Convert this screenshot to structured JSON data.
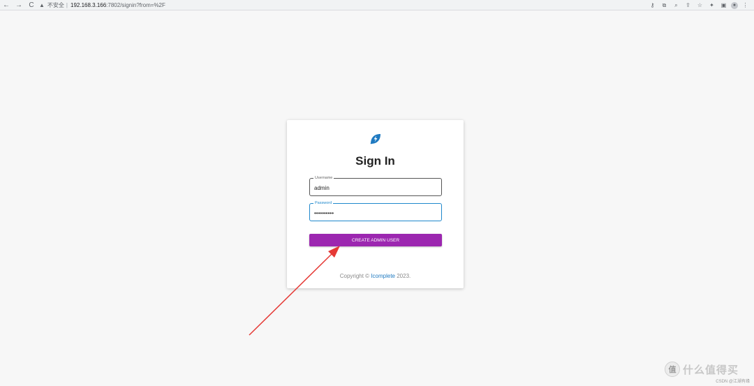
{
  "browser": {
    "back_icon": "←",
    "forward_icon": "→",
    "reload_icon": "C",
    "security_label": "不安全",
    "separator": "|",
    "url_host": "192.168.3.166",
    "url_path": ":7802/signin?from=%2F",
    "icons": [
      "key-icon",
      "translate-icon",
      "zoom-icon",
      "share-icon",
      "star-icon",
      "extensions-icon",
      "sidepanel-icon",
      "profile-icon",
      "menu-icon"
    ]
  },
  "signin": {
    "title": "Sign In",
    "username_label": "Username",
    "username_value": "admin",
    "password_label": "Password",
    "password_value": "••••••••••",
    "submit_label": "CREATE ADMIN USER",
    "copyright_prefix": "Copyright ©",
    "copyright_brand": "Icomplete",
    "copyright_year": "2023."
  },
  "colors": {
    "button": "#9c27b0",
    "focus": "#1f88cc",
    "arrow": "#e53935",
    "logo": "#1f7ac1"
  },
  "watermark": {
    "badge": "值",
    "text": "什么值得买",
    "credit": "CSDN @江湖有缘"
  }
}
